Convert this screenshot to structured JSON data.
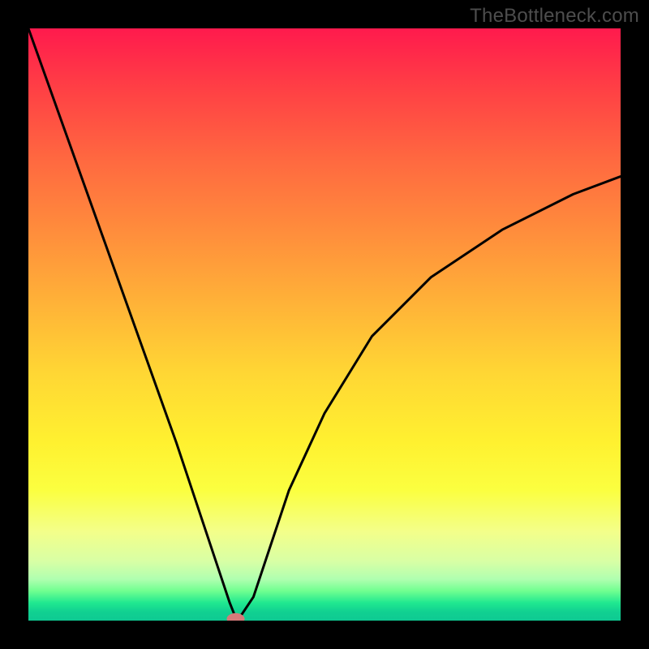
{
  "watermark": "TheBottleneck.com",
  "chart_data": {
    "type": "line",
    "title": "",
    "xlabel": "",
    "ylabel": "",
    "xlim": [
      0,
      100
    ],
    "ylim": [
      0,
      100
    ],
    "background_gradient": {
      "top": "#ff1a4d",
      "mid": "#fff130",
      "bottom": "#0ec992"
    },
    "series": [
      {
        "name": "bottleneck-curve",
        "x": [
          0,
          5,
          10,
          15,
          20,
          25,
          28,
          30,
          32,
          34,
          35,
          36,
          38,
          40,
          44,
          50,
          58,
          68,
          80,
          92,
          100
        ],
        "values": [
          100,
          86,
          72,
          58,
          44,
          30,
          21,
          15,
          9,
          3,
          0.5,
          1,
          4,
          10,
          22,
          35,
          48,
          58,
          66,
          72,
          75
        ]
      }
    ],
    "marker": {
      "name": "optimum-marker",
      "x": 35,
      "y": 0.3,
      "color": "#d57a7a"
    }
  }
}
